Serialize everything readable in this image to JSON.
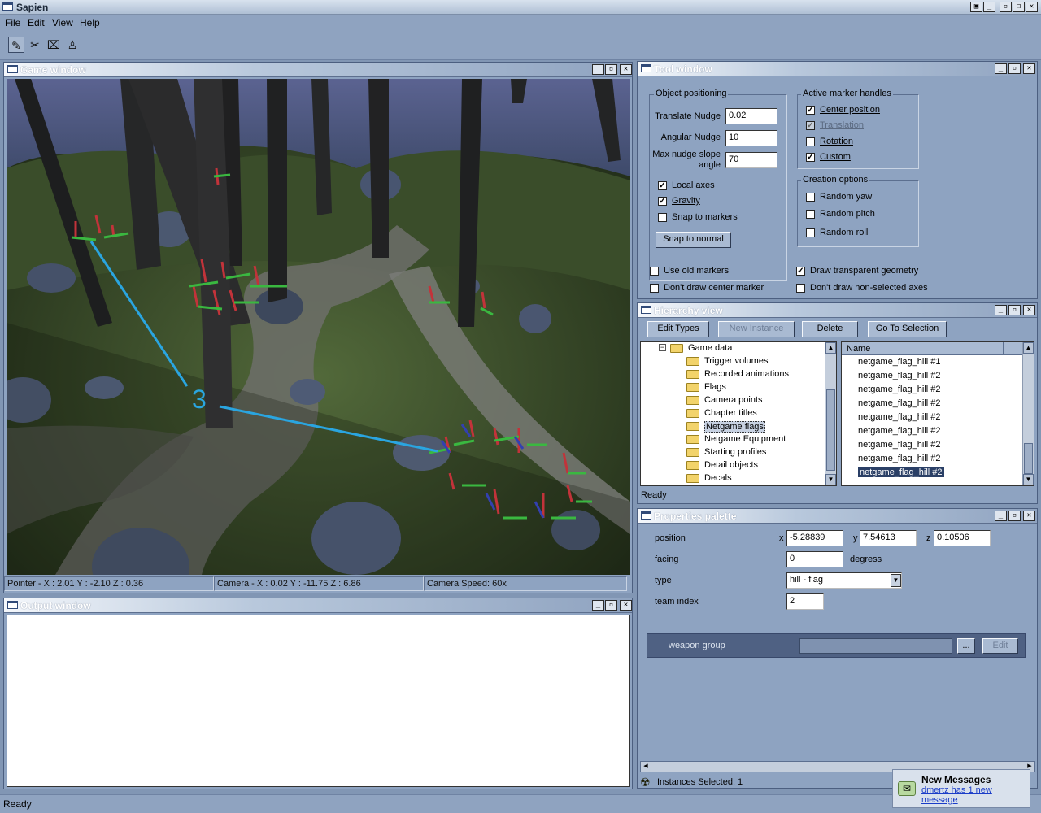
{
  "app": {
    "title": "Sapien"
  },
  "menu": [
    "File",
    "Edit",
    "View",
    "Help"
  ],
  "toolbar": {
    "icons": [
      "pencil-icon",
      "scissors-icon",
      "camera-icon",
      "player-icon"
    ]
  },
  "game_window": {
    "title": "Game window",
    "overlay_number": "3",
    "status": {
      "pointer": "Pointer - X : 2.01  Y : -2.10  Z : 0.36",
      "camera": "Camera - X : 0.02  Y : -11.75  Z : 6.86",
      "speed": "Camera Speed: 60x"
    }
  },
  "output_window": {
    "title": "Output window"
  },
  "tool_window": {
    "title": "Tool window",
    "object_positioning": {
      "label": "Object positioning",
      "translate_nudge_label": "Translate Nudge",
      "translate_nudge_value": "0.02",
      "angular_nudge_label": "Angular Nudge",
      "angular_nudge_value": "10",
      "max_slope_label_1": "Max nudge slope",
      "max_slope_label_2": "angle",
      "max_slope_value": "70",
      "local_axes": "Local axes",
      "gravity": "Gravity",
      "snap_markers": "Snap to markers",
      "snap_normal": "Snap to normal"
    },
    "marker_handles": {
      "label": "Active marker handles",
      "center": "Center position",
      "translation": "Translation",
      "rotation": "Rotation",
      "custom": "Custom"
    },
    "creation": {
      "label": "Creation options",
      "yaw": "Random yaw",
      "pitch": "Random pitch",
      "roll": "Random roll"
    },
    "use_old_markers": "Use old markers",
    "dont_draw_center": "Don't draw center marker",
    "draw_transparent": "Draw transparent geometry",
    "dont_draw_axes": "Don't draw non-selected axes"
  },
  "hierarchy": {
    "title": "Hierarchy view",
    "buttons": {
      "edit_types": "Edit Types",
      "new_instance": "New Instance",
      "delete": "Delete",
      "go_to_selection": "Go To Selection"
    },
    "tree_root": "Game data",
    "tree_items": [
      "Trigger volumes",
      "Recorded animations",
      "Flags",
      "Camera points",
      "Chapter titles",
      "Netgame flags",
      "Netgame Equipment",
      "Starting profiles",
      "Detail objects",
      "Decals"
    ],
    "selected_tree": "Netgame flags",
    "list_header": "Name",
    "list_items": [
      "netgame_flag_hill #1",
      "netgame_flag_hill #2",
      "netgame_flag_hill #2",
      "netgame_flag_hill #2",
      "netgame_flag_hill #2",
      "netgame_flag_hill #2",
      "netgame_flag_hill #2",
      "netgame_flag_hill #2",
      "netgame_flag_hill #2"
    ],
    "status": "Ready"
  },
  "properties": {
    "title": "Properties palette",
    "position_label": "position",
    "x_label": "x",
    "x": "-5.28839",
    "y_label": "y",
    "y": "7.54613",
    "z_label": "z",
    "z": "0.10506",
    "facing_label": "facing",
    "facing": "0",
    "degrees": "degress",
    "type_label": "type",
    "type": "hill - flag",
    "team_label": "team index",
    "team": "2",
    "weapon_group_label": "weapon group",
    "browse": "...",
    "edit": "Edit",
    "instances_selected": "Instances Selected: 1"
  },
  "status_bar": {
    "text": "Ready"
  },
  "notification": {
    "title": "New Messages",
    "text": "dmertz has 1 new message"
  }
}
